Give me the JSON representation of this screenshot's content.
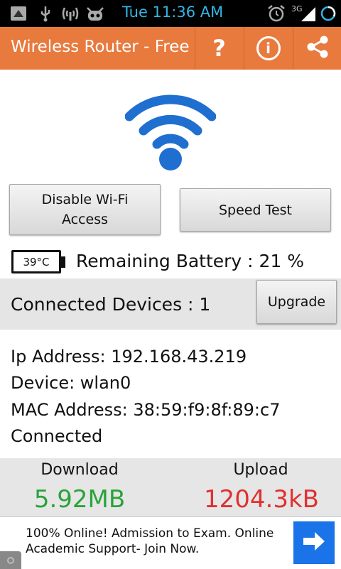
{
  "status_bar": {
    "time": "Tue 11:36 AM",
    "network": "3G",
    "icons": [
      "notification-icon",
      "usb-icon",
      "hotspot-icon",
      "android-icon",
      "alarm-icon",
      "signal-icon",
      "battery-icon"
    ],
    "accent_color": "#33b5e5"
  },
  "action_bar": {
    "title": "Wireless Router - Free",
    "help_label": "?",
    "info_label": "i",
    "background_color": "#e87a3e",
    "icons": [
      "help-icon",
      "info-icon",
      "share-icon"
    ]
  },
  "main": {
    "wifi_icon_color": "#1f6fd0",
    "disable_button_label": "Disable Wi-Fi Access",
    "speed_test_button_label": "Speed Test",
    "battery_temp": "39°C",
    "remaining_battery": "Remaining Battery : 21 %"
  },
  "devices": {
    "label": "Connected Devices : 1",
    "upgrade_label": "Upgrade"
  },
  "info": {
    "ip": "Ip Address: 192.168.43.219",
    "device": "Device: wlan0",
    "mac": "MAC Address: 38:59:f9:8f:89:c7",
    "status": "Connected"
  },
  "traffic": {
    "download_label": "Download",
    "download_value": "5.92MB",
    "download_color": "#2aa33a",
    "upload_label": "Upload",
    "upload_value": "1204.3kB",
    "upload_color": "#e03030"
  },
  "ad": {
    "text": "100% Online! Admission to Exam. Online Academic Support- Join Now.",
    "arrow_color": "#1a73e8"
  }
}
